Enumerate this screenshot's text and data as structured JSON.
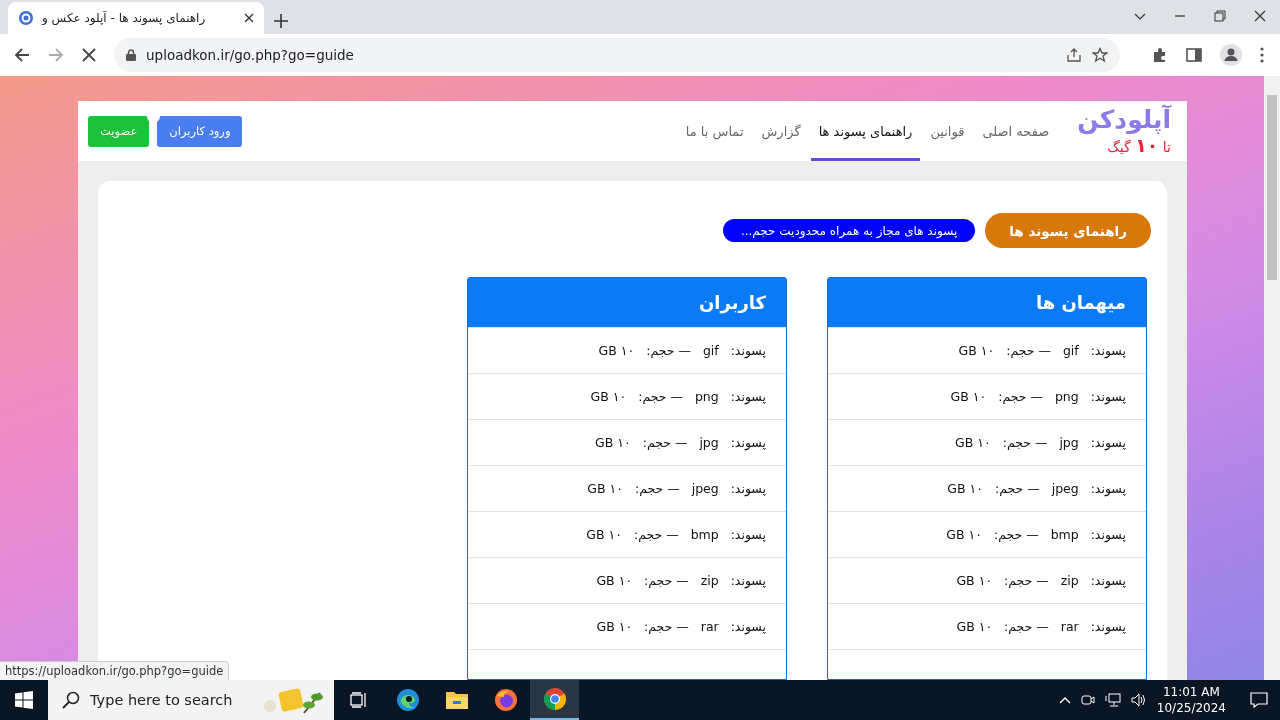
{
  "browser": {
    "tab_title": "راهنمای پسوند ها - آپلود عکس و",
    "url": "uploadkon.ir/go.php?go=guide",
    "status_url": "https://uploadkon.ir/go.php?go=guide"
  },
  "site": {
    "logo": "آپلودکن",
    "tagline": "تا **۱۰** گیگ",
    "nav": [
      {
        "label": "صفحه اصلی",
        "selected": false
      },
      {
        "label": "قوانین",
        "selected": false
      },
      {
        "label": "راهنمای پسوند ها",
        "selected": true
      },
      {
        "label": "گزارش",
        "selected": false
      },
      {
        "label": "تماس با ما",
        "selected": false
      }
    ],
    "buttons": [
      {
        "label": "ورود کاربران",
        "kind": "login"
      },
      {
        "label": "عضویت",
        "kind": "register"
      }
    ]
  },
  "guide": {
    "title_pill": "راهنمای پسوند ها",
    "note_pill": "پسوند های مجاز به همراه محدودیت حجم...",
    "tables": [
      {
        "title": "میهمان ها",
        "rows": [
          "پسوند:   gif   — حجم:   ۱۰ GB",
          "پسوند:   png   — حجم:   ۱۰ GB",
          "پسوند:   jpg   — حجم:   ۱۰ GB",
          "پسوند:   jpeg   — حجم:   ۱۰ GB",
          "پسوند:   bmp   — حجم:   ۱۰ GB",
          "پسوند:   zip   — حجم:   ۱۰ GB",
          "پسوند:   rar   — حجم:   ۱۰ GB"
        ]
      },
      {
        "title": "کاربران",
        "rows": [
          "پسوند:   gif   — حجم:   ۱۰ GB",
          "پسوند:   png   — حجم:   ۱۰ GB",
          "پسوند:   jpg   — حجم:   ۱۰ GB",
          "پسوند:   jpeg   — حجم:   ۱۰ GB",
          "پسوند:   bmp   — حجم:   ۱۰ GB",
          "پسوند:   zip   — حجم:   ۱۰ GB",
          "پسوند:   rar   — حجم:   ۱۰ GB"
        ]
      }
    ]
  },
  "taskbar": {
    "search_placeholder": "Type here to search",
    "time": "11:01 AM",
    "date": "10/25/2024"
  }
}
